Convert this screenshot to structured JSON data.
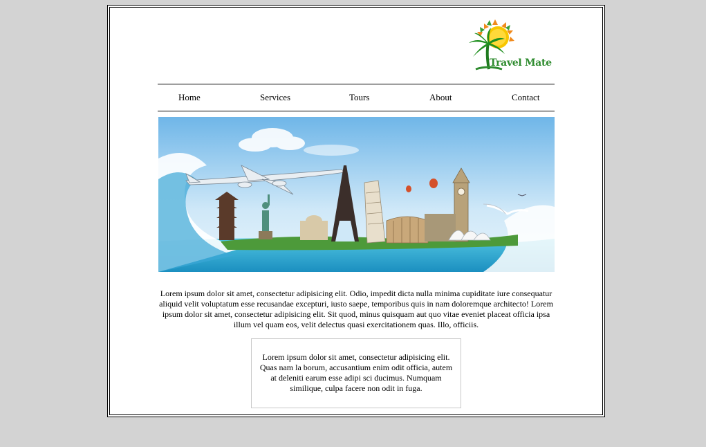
{
  "brand": {
    "name": "Travel Mate"
  },
  "nav": {
    "items": [
      {
        "label": "Home"
      },
      {
        "label": "Services"
      },
      {
        "label": "Tours"
      },
      {
        "label": "About"
      },
      {
        "label": "Contact"
      }
    ]
  },
  "hero": {
    "image": "travel-landmarks-banner"
  },
  "main": {
    "intro": "Lorem ipsum dolor sit amet, consectetur adipisicing elit. Odio, impedit dicta nulla minima cupiditate iure consequatur aliquid velit voluptatum esse recusandae excepturi, iusto saepe, temporibus quis in nam doloremque architecto! Lorem ipsum dolor sit amet, consectetur adipisicing elit. Sit quod, minus quisquam aut quo vitae eveniet placeat officia ipsa illum vel quam eos, velit delectus quasi exercitationem quas. Illo, officiis.",
    "callout": "Lorem ipsum dolor sit amet, consectetur adipisicing elit. Quas nam la borum, accusantium enim odit officia, autem at deleniti earum esse adipi sci ducimus. Numquam similique, culpa facere non odit in fuga."
  },
  "colors": {
    "page_background": "#d3d3d3",
    "frame_background": "#ffffff",
    "logo_text": "#2e8b2e",
    "sun": "#f7c600",
    "sun_rays": "#f08a1c"
  }
}
